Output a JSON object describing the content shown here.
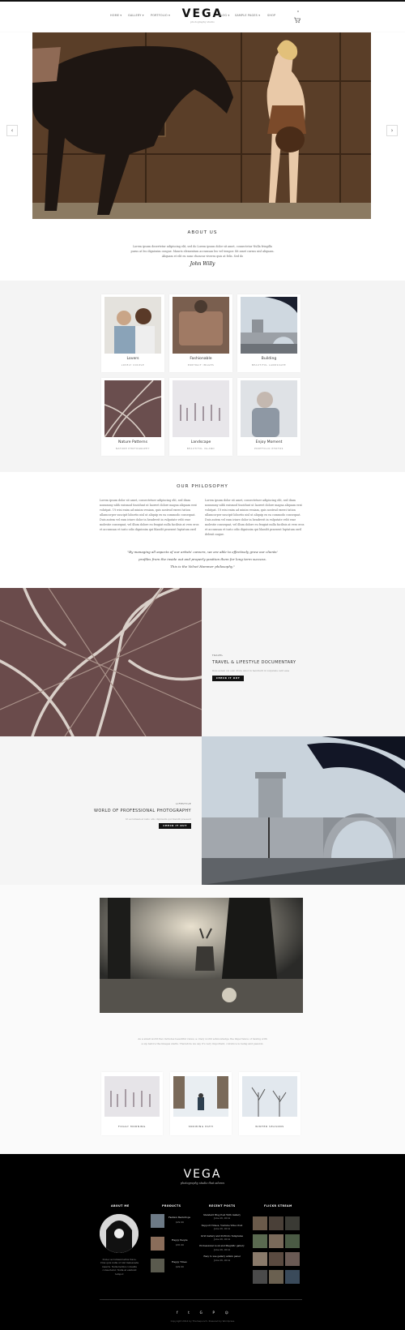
{
  "header": {
    "logo": "VEGA",
    "tagline": "photography studio",
    "nav_left": [
      "HOME",
      "GALLERY",
      "PORTFOLIO"
    ],
    "nav_right": [
      "BLOG",
      "SAMPLE PAGES",
      "SHOP"
    ],
    "cart_count": "0"
  },
  "slider": {
    "prev": "‹",
    "next": "›"
  },
  "about": {
    "title": "ABOUT US",
    "text": [
      "Lorem ipsum dosertetur adipiscing elit, sed do Lorem ipsum dolor sit amet, consectetur Nulla fringilla",
      "purus at leo dignissim congue. Mauris elementum accumsan leo vel tempor. Sit amet cursus nisl aliquam.",
      "Aliquam et elit eu nunc rhoncus viverra quis at felis. Sed do"
    ],
    "signature": "John Willy"
  },
  "gallery": [
    {
      "title": "Lovers",
      "subtitle": "LOVELY COUPLE"
    },
    {
      "title": "Fashionable",
      "subtitle": "PORTRAIT IMAGES"
    },
    {
      "title": "Building",
      "subtitle": "BEAUTIFUL LANDSCAPE"
    },
    {
      "title": "Nature Patterns",
      "subtitle": "NATURE PHOTOGRAPHY"
    },
    {
      "title": "Landscape",
      "subtitle": "BEAUTIFUL ISLAND"
    },
    {
      "title": "Enjoy Moment",
      "subtitle": "PORTFOLIO PHOTOS"
    }
  ],
  "philosophy": {
    "title": "OUR PHILOSOPHY",
    "col1": [
      "Lorem ipsum dolor sit amet, consectetuer adipiscing elit, sed diam",
      "nonummy nibh euismod tincidunt ut laoreet dolore magna aliquam erat",
      "volutpat. Ut wisi enim ad minim veniam, quis nostrud exerci tation",
      "ullamcorper suscipit lobortis nisl ut aliquip ex ea commodo consequat.",
      "Duis autem vel eum iriure dolor in hendrerit in vulputate velit esse",
      "molestie consequat, vel illum dolore eu feugiat nulla facilisis at vero eros",
      "et accumsan et iusto odio dignissim qui blandit praesent luptatum zzril"
    ],
    "col2": [
      "Lorem ipsum dolor sit amet, consectetuer adipiscing elit, sed diam",
      "nonummy nibh euismod tincidunt ut laoreet dolore magna aliquam erat",
      "volutpat. Ut wisi enim ad minim veniam, quis nostrud exerci tation",
      "ullamcorper suscipit lobortis nisl ut aliquip ex ea commodo consequat.",
      "Duis autem vel eum iriure dolor in hendrerit in vulputate velit esse",
      "molestie consequat, vel illum dolore eu feugiat nulla facilisis at vero eros",
      "et accumsan et iusto odio dignissim qui blandit praesent luptatum zzril",
      "delenit augue."
    ],
    "quote": [
      "\"By managing all aspects of our artists' careers, we are able to effectively grow our clients'",
      "profiles from the inside out and properly position them for long term success.",
      "This is the Velvet Hammer philosophy.\""
    ]
  },
  "feature1": {
    "kicker": "TRAVEL",
    "title": "TRAVEL & LIFESTYLE DOCUMENTARY",
    "text": "Duis autem vel eum iriure dolor in hendrerit in vulputate velit esse",
    "button": "CHECK IT OUT"
  },
  "feature2": {
    "kicker": "LIFESTYLE",
    "title": "WORLD OF PROFESSIONAL PHOTOGRAPHY",
    "text": "Ut accumsan et iusto odio dignissim qui blandit praesent",
    "button": "CHECK IT OUT"
  },
  "intro_text": [
    "As a small world flex includes beautiful views, a crazy world acknowledge the importance of having with",
    "a sip before the images starts. Therefore we say it's very important, convince is being and passion."
  ],
  "small_gallery": [
    "FOGGY MORNING",
    "SNOWING PATH",
    "WINTER SEASONS"
  ],
  "footer": {
    "logo": "VEGA",
    "tagline": "photography studio that adores",
    "about_title": "ABOUT ME",
    "about_text": [
      "Donec accumsan tellus fusce.",
      "Cras quis nulla ut nisl malesuada",
      "mauris. Nulla facilisi convallis",
      "consectetur. Nulla at eleifend",
      "tempor."
    ],
    "products_title": "PRODUCTS",
    "products": [
      {
        "name": "Fashion Backdrops",
        "price": "$29.99"
      },
      {
        "name": "Happy People",
        "price": "$35.99"
      },
      {
        "name": "Happy Times",
        "price": "$29.99"
      }
    ],
    "posts_title": "RECENT POSTS",
    "posts": [
      {
        "title": "Standard Blog Post With Gallery",
        "date": "June 26, 2014"
      },
      {
        "title": "Support Videos, Youtube Video Post",
        "date": "June 26, 2014"
      },
      {
        "title": "Grid Gallery and Portfolio Templates",
        "date": "June 26, 2014"
      },
      {
        "title": "Professional Look and Magnific gallery",
        "date": "June 26, 2014"
      },
      {
        "title": "Easy to use gallery admin panel",
        "date": "June 26, 2014"
      }
    ],
    "flickr_title": "FLICKR STREAM",
    "social": [
      "f",
      "t",
      "G",
      "P",
      "☺"
    ],
    "copyright": "Copyright 2014 by Themepunch. Powered by Wordpress"
  },
  "colors": {
    "accent": "#111111",
    "bg": "#fafafa",
    "footer": "#000000"
  }
}
